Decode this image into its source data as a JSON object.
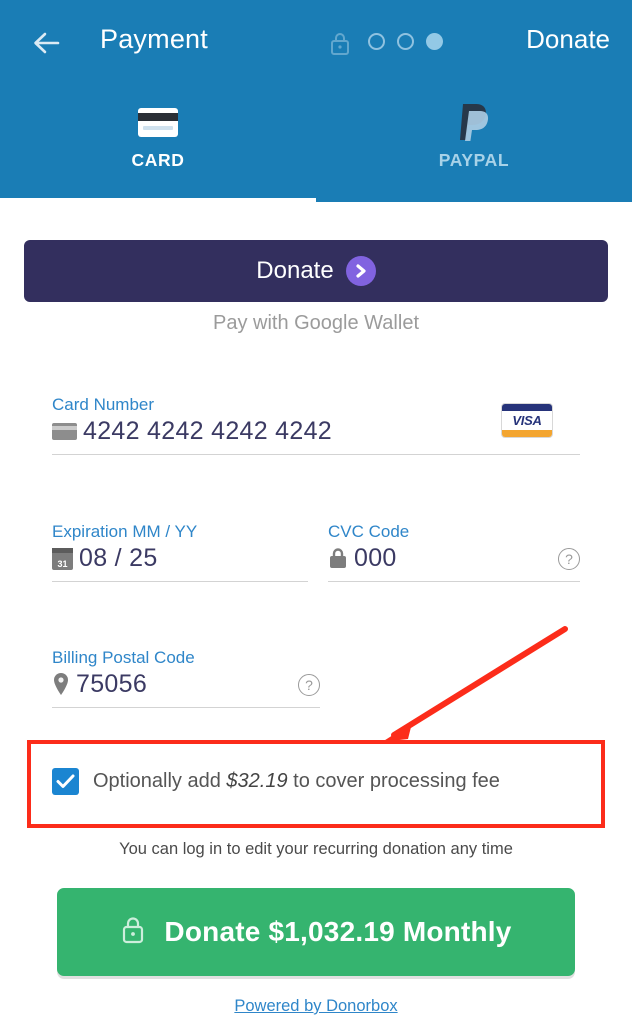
{
  "header": {
    "back_icon": "back-arrow-icon",
    "title": "Payment",
    "lock_icon": "lock-icon",
    "progress_dots": [
      "hollow",
      "hollow",
      "filled"
    ],
    "donate_link": "Donate"
  },
  "tabs": [
    {
      "id": "card",
      "label": "CARD",
      "icon": "credit-card-icon",
      "active": true
    },
    {
      "id": "paypal",
      "label": "PAYPAL",
      "icon": "paypal-icon",
      "active": false
    }
  ],
  "wallet": {
    "button_label": "Donate",
    "logo_icon": "donorbox-chevron-icon",
    "subtitle": "Pay with Google Wallet"
  },
  "form": {
    "card_number": {
      "label": "Card Number",
      "value": "4242 4242 4242 4242",
      "icon": "credit-card-icon",
      "brand": "VISA"
    },
    "expiration": {
      "label": "Expiration MM / YY",
      "value": "08 / 25",
      "icon": "calendar-icon",
      "calendar_day": "31"
    },
    "cvc": {
      "label": "CVC Code",
      "value": "000",
      "icon": "lock-icon",
      "help_icon": "help-circle-icon"
    },
    "postal": {
      "label": "Billing Postal Code",
      "value": "75056",
      "icon": "map-pin-icon",
      "help_icon": "help-circle-icon"
    }
  },
  "fee": {
    "checked": true,
    "check_icon": "checkmark-icon",
    "text_before": "Optionally add ",
    "amount": "$32.19",
    "text_after": " to cover processing fee"
  },
  "footer": {
    "recurring_note": "You can log in to edit your recurring donation any time",
    "submit_label": "Donate $1,032.19 Monthly",
    "submit_lock_icon": "lock-icon",
    "powered_by": "Powered by Donorbox"
  },
  "annotations": {
    "highlight_box": "red-rectangle-highlight",
    "arrow": "red-arrow-pointing-to-fee-checkbox"
  },
  "colors": {
    "header_blue": "#1a7db5",
    "wallet_navy": "#332f5e",
    "donorbox_purple": "#8163e0",
    "link_blue": "#2f86c9",
    "value_navy": "#3b3a63",
    "submit_green": "#35b46f",
    "checkbox_blue": "#1b85d1",
    "annotation_red": "#fc2c1a"
  }
}
